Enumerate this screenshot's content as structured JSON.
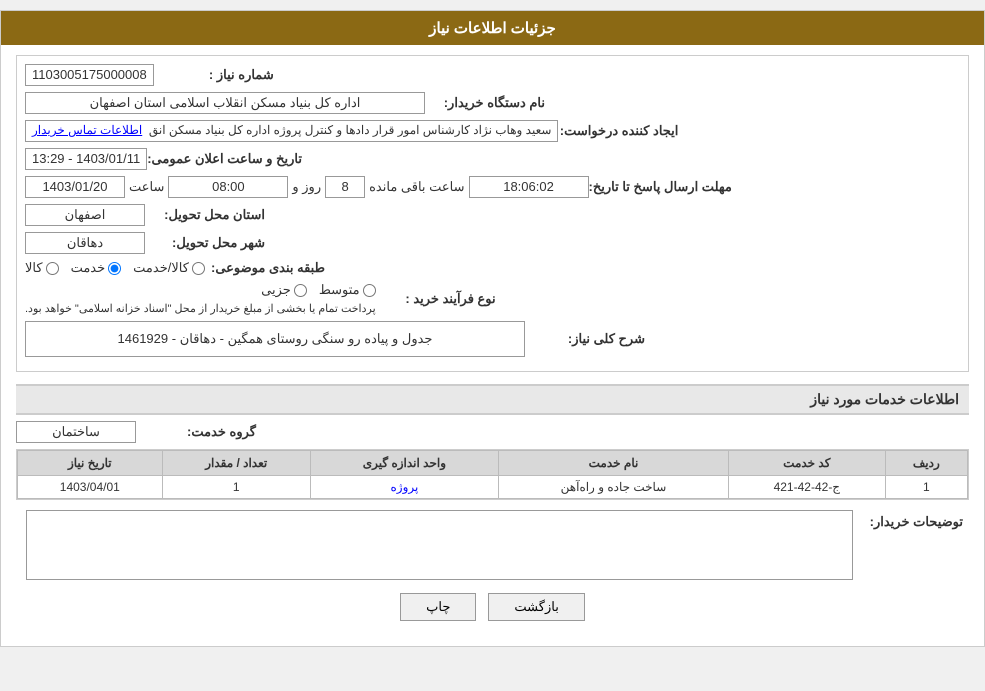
{
  "header": {
    "title": "جزئیات اطلاعات نیاز"
  },
  "fields": {
    "need_number_label": "شماره نیاز :",
    "need_number_value": "1103005175000008",
    "buyer_org_label": "نام دستگاه خریدار:",
    "buyer_org_value": "اداره کل بنیاد مسکن انقلاب اسلامی استان اصفهان",
    "requester_label": "ایجاد کننده درخواست:",
    "requester_value": "سعید وهاب نژاد کارشناس امور قرار دادها و کنترل  پروژه اداره کل بنیاد مسکن انق",
    "contact_link": "اطلاعات تماس خریدار",
    "date_label": "تاریخ و ساعت اعلان عمومی:",
    "date_value": "1403/01/11 - 13:29",
    "response_deadline_label": "مهلت ارسال پاسخ تا تاریخ:",
    "response_date_value": "1403/01/20",
    "response_time_label": "ساعت",
    "response_time_value": "08:00",
    "response_days_label": "روز و",
    "response_days_value": "8",
    "response_remaining_label": "ساعت باقی مانده",
    "response_remaining_value": "18:06:02",
    "delivery_province_label": "استان محل تحویل:",
    "delivery_province_value": "اصفهان",
    "delivery_city_label": "شهر محل تحویل:",
    "delivery_city_value": "دهاقان",
    "subject_label": "طبقه بندی موضوعی:",
    "subject_options": [
      {
        "value": "کالا",
        "name": "goods"
      },
      {
        "value": "خدمت",
        "name": "service"
      },
      {
        "value": "کالا/خدمت",
        "name": "goods_service"
      }
    ],
    "subject_selected": "خدمت",
    "purchase_type_label": "نوع فرآیند خرید :",
    "purchase_types": [
      {
        "value": "جزیی",
        "name": "partial"
      },
      {
        "value": "متوسط",
        "name": "medium"
      },
      {
        "value": "notice",
        "name": "notice"
      }
    ],
    "purchase_notice": "پرداخت تمام یا بخشی از مبلغ خریدار از محل \"اسناد خزانه اسلامی\" خواهد بود.",
    "description_label": "شرح کلی نیاز:",
    "description_value": "جدول و پیاده رو سنگی روستای همگین - دهاقان - 1461929"
  },
  "service_info": {
    "section_title": "اطلاعات خدمات مورد نیاز",
    "service_group_label": "گروه خدمت:",
    "service_group_value": "ساختمان",
    "table_headers": [
      "ردیف",
      "کد خدمت",
      "نام خدمت",
      "واحد اندازه گیری",
      "تعداد / مقدار",
      "تاریخ نیاز"
    ],
    "table_rows": [
      {
        "row_num": "1",
        "service_code": "ج-42-42-421",
        "service_name": "ساخت جاده و راه‌آهن",
        "unit": "پروژه",
        "quantity": "1",
        "need_date": "1403/04/01"
      }
    ]
  },
  "buyer_notes": {
    "label": "توضیحات خریدار:",
    "value": ""
  },
  "buttons": {
    "print_label": "چاپ",
    "back_label": "بازگشت"
  }
}
